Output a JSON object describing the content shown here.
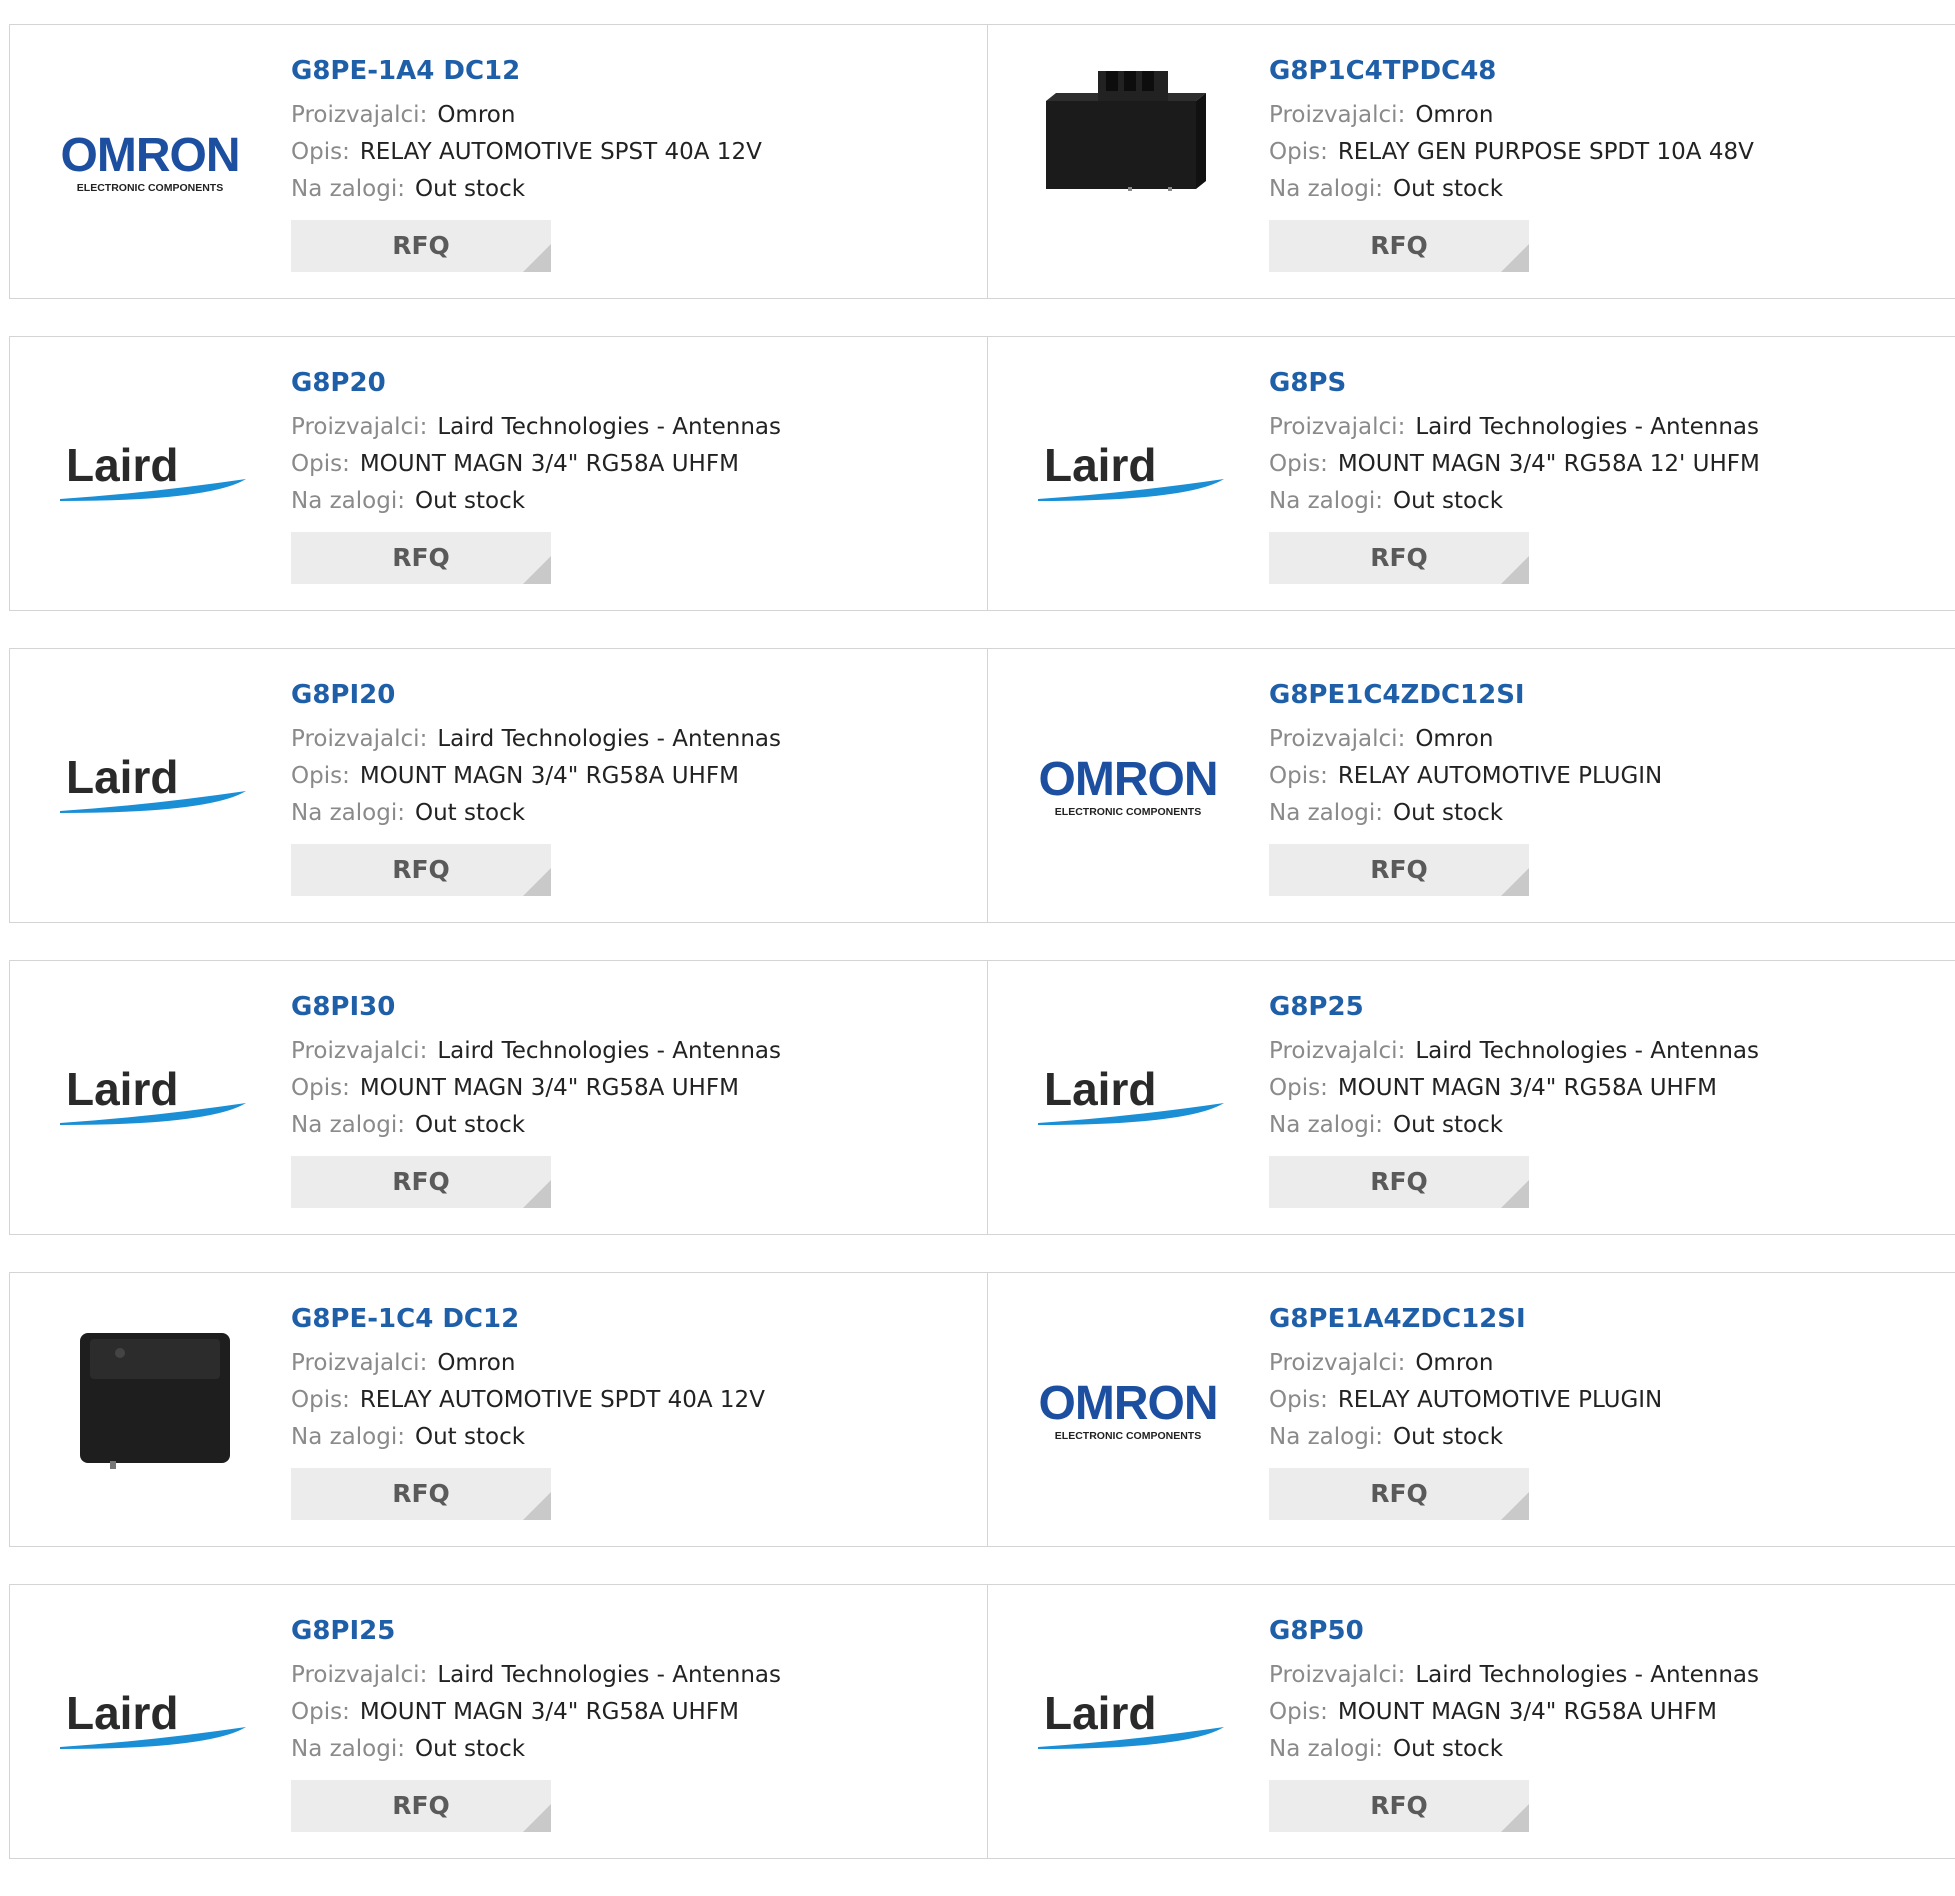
{
  "labels": {
    "manufacturer": "Proizvajalci:",
    "description": "Opis:",
    "stock": "Na zalogi:",
    "rfq": "RFQ"
  },
  "logo_text": {
    "omron": "OMRON",
    "omron_sub": "ELECTRONIC COMPONENTS",
    "laird": "Laird"
  },
  "products": [
    {
      "part": "G8PE-1A4 DC12",
      "manufacturer": "Omron",
      "description": "RELAY AUTOMOTIVE SPST 40A 12V",
      "stock": "Out stock",
      "image": "omron-logo"
    },
    {
      "part": "G8P1C4TPDC48",
      "manufacturer": "Omron",
      "description": "RELAY GEN PURPOSE SPDT 10A 48V",
      "stock": "Out stock",
      "image": "relay-photo-tall"
    },
    {
      "part": "G8P20",
      "manufacturer": "Laird Technologies - Antennas",
      "description": "MOUNT MAGN 3/4\" RG58A UHFM",
      "stock": "Out stock",
      "image": "laird-logo"
    },
    {
      "part": "G8PS",
      "manufacturer": "Laird Technologies - Antennas",
      "description": "MOUNT MAGN 3/4\" RG58A 12' UHFM",
      "stock": "Out stock",
      "image": "laird-logo"
    },
    {
      "part": "G8PI20",
      "manufacturer": "Laird Technologies - Antennas",
      "description": "MOUNT MAGN 3/4\" RG58A UHFM",
      "stock": "Out stock",
      "image": "laird-logo"
    },
    {
      "part": "G8PE1C4ZDC12SI",
      "manufacturer": "Omron",
      "description": "RELAY AUTOMOTIVE PLUGIN",
      "stock": "Out stock",
      "image": "omron-logo"
    },
    {
      "part": "G8PI30",
      "manufacturer": "Laird Technologies - Antennas",
      "description": "MOUNT MAGN 3/4\" RG58A UHFM",
      "stock": "Out stock",
      "image": "laird-logo"
    },
    {
      "part": "G8P25",
      "manufacturer": "Laird Technologies - Antennas",
      "description": "MOUNT MAGN 3/4\" RG58A UHFM",
      "stock": "Out stock",
      "image": "laird-logo"
    },
    {
      "part": "G8PE-1C4 DC12",
      "manufacturer": "Omron",
      "description": "RELAY AUTOMOTIVE SPDT 40A 12V",
      "stock": "Out stock",
      "image": "relay-photo-cube"
    },
    {
      "part": "G8PE1A4ZDC12SI",
      "manufacturer": "Omron",
      "description": "RELAY AUTOMOTIVE PLUGIN",
      "stock": "Out stock",
      "image": "omron-logo"
    },
    {
      "part": "G8PI25",
      "manufacturer": "Laird Technologies - Antennas",
      "description": "MOUNT MAGN 3/4\" RG58A UHFM",
      "stock": "Out stock",
      "image": "laird-logo"
    },
    {
      "part": "G8P50",
      "manufacturer": "Laird Technologies - Antennas",
      "description": "MOUNT MAGN 3/4\" RG58A UHFM",
      "stock": "Out stock",
      "image": "laird-logo"
    }
  ],
  "colors": {
    "part_link": "#1f5fa8",
    "omron_blue": "#1c4fa0",
    "laird_swoosh": "#1a8fd6",
    "rfq_bg": "#ececec"
  }
}
